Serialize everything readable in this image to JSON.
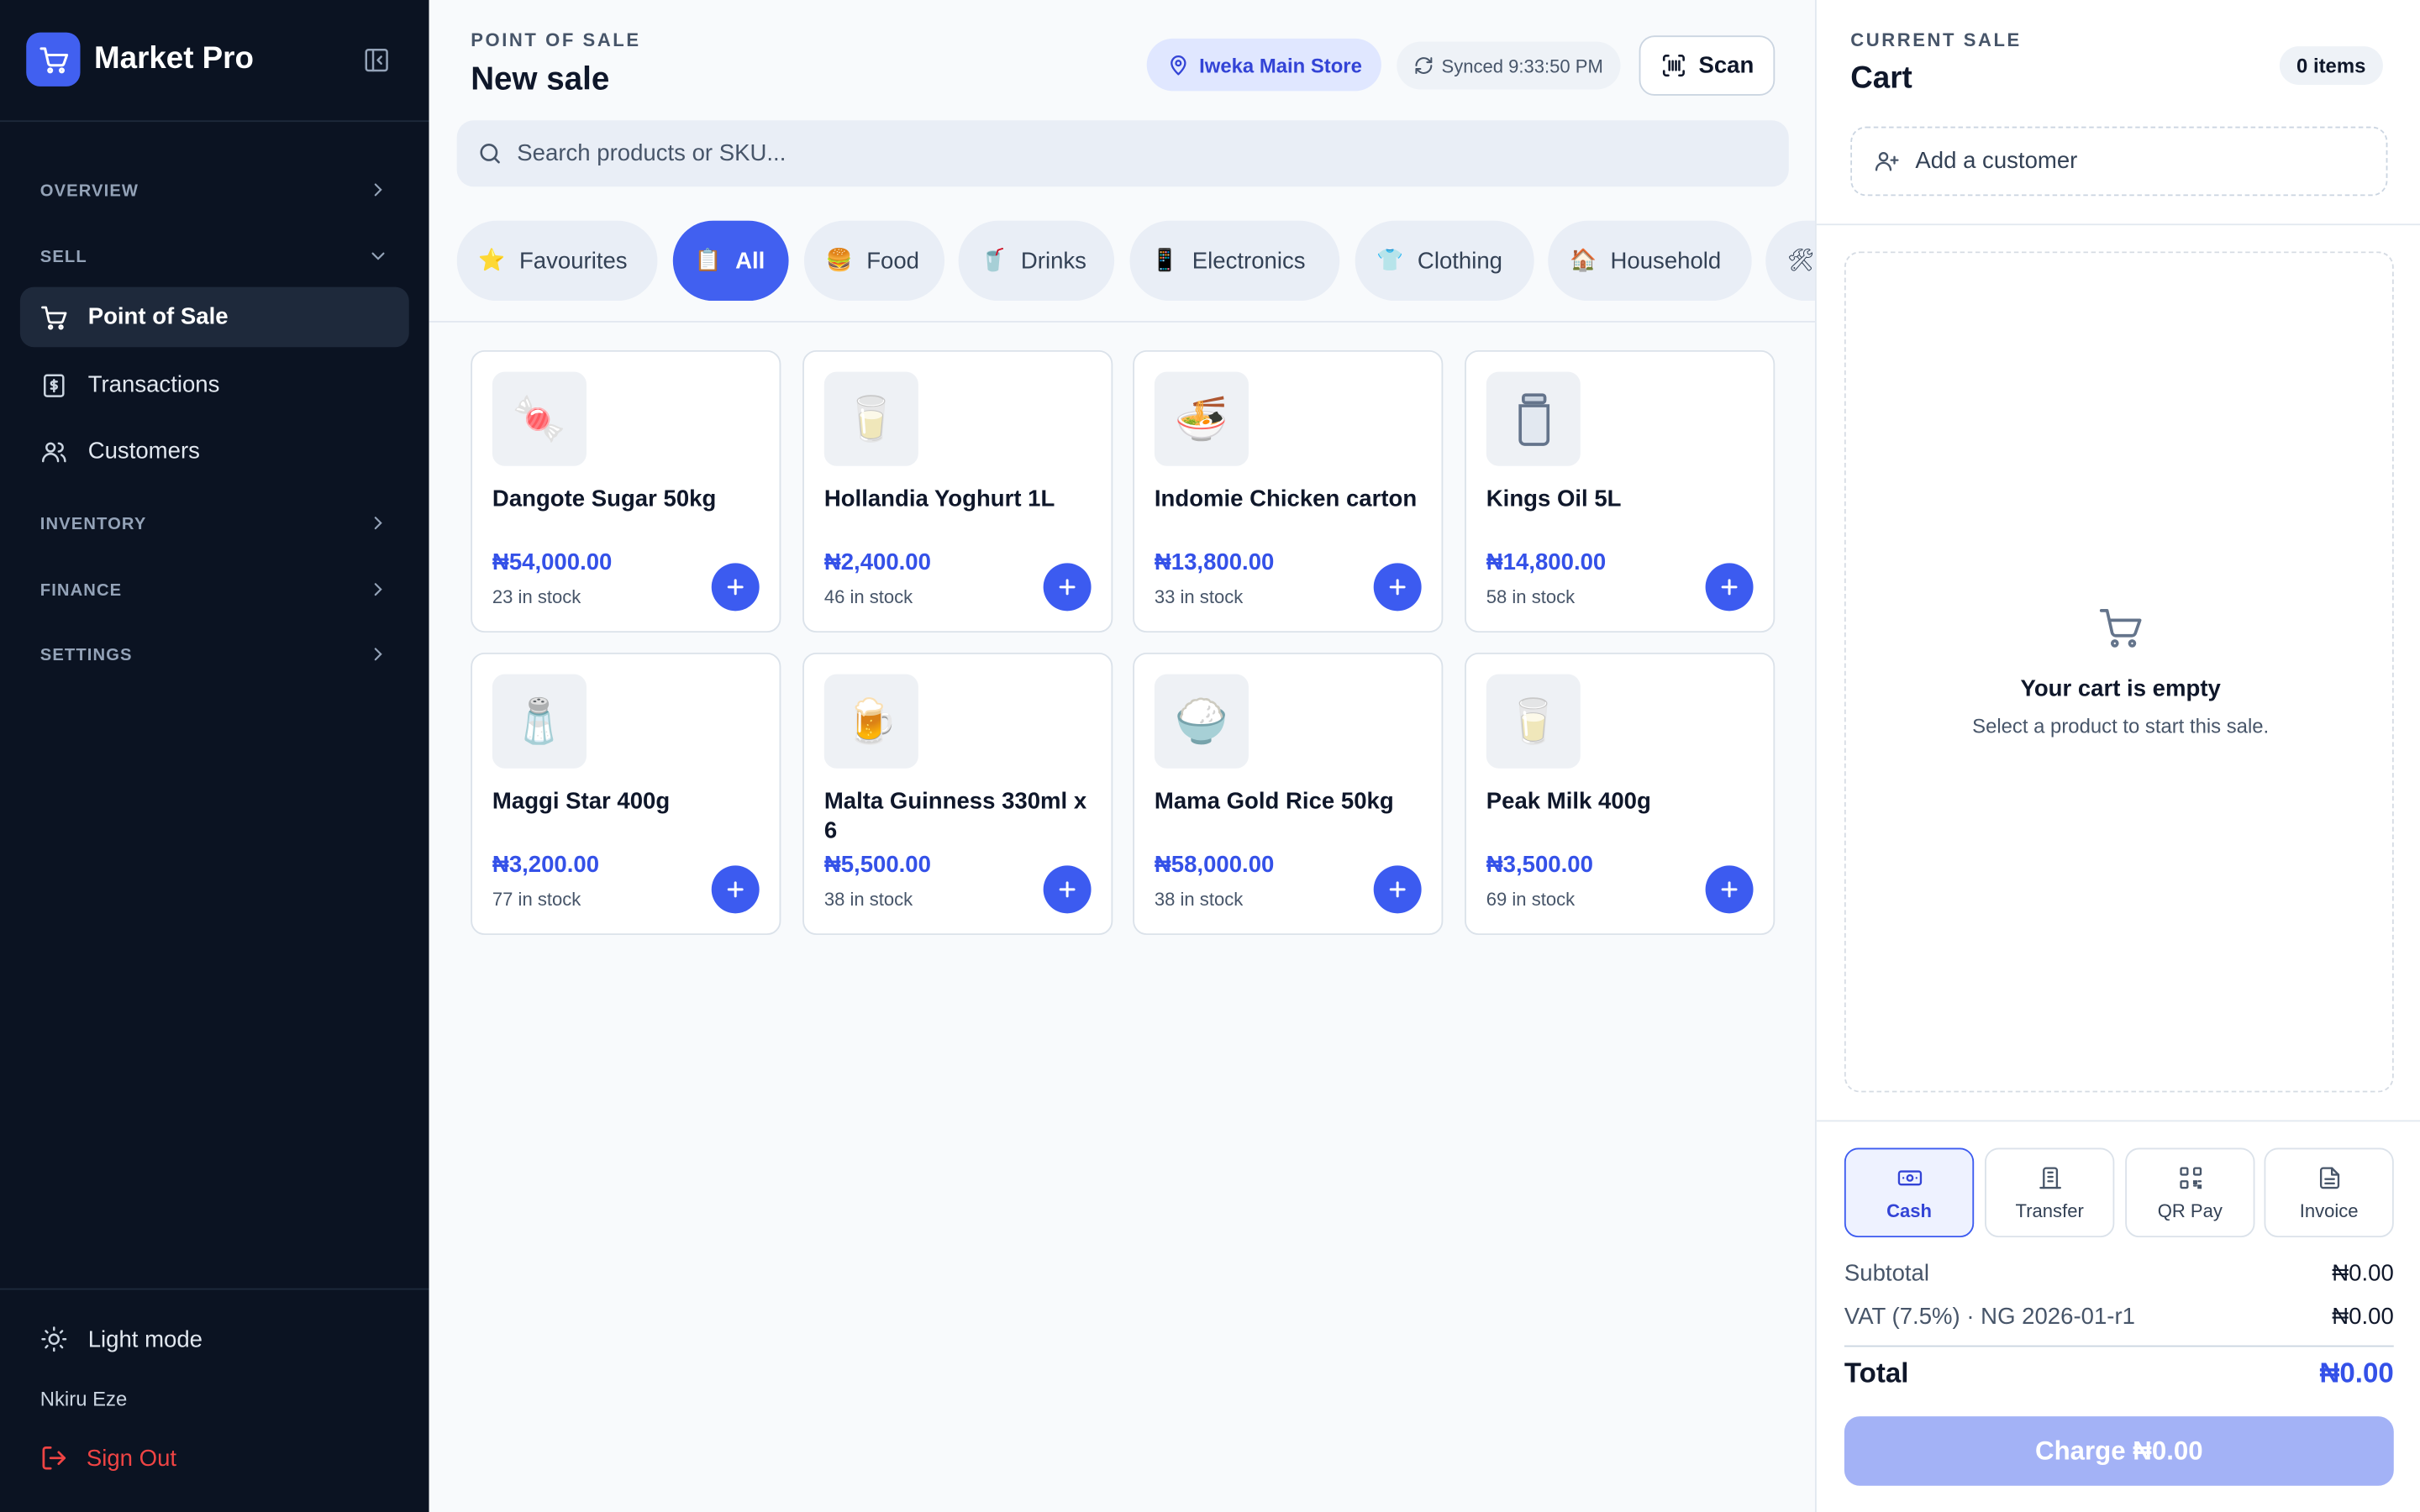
{
  "app": {
    "name": "Market Pro"
  },
  "sidebar": {
    "sections": {
      "overview": "OVERVIEW",
      "sell": "SELL",
      "inventory": "INVENTORY",
      "finance": "FINANCE",
      "settings": "SETTINGS"
    },
    "items": [
      {
        "label": "Point of Sale",
        "active": true
      },
      {
        "label": "Transactions",
        "active": false
      },
      {
        "label": "Customers",
        "active": false
      }
    ],
    "light_mode": "Light mode",
    "user_name": "Nkiru Eze",
    "sign_out": "Sign Out"
  },
  "header": {
    "eyebrow": "POINT OF SALE",
    "title": "New sale",
    "store": "Iweka Main Store",
    "sync": "Synced 9:33:50 PM",
    "scan": "Scan"
  },
  "search": {
    "placeholder": "Search products or SKU..."
  },
  "categories": [
    {
      "label": "Favourites",
      "emoji": "⭐",
      "active": false
    },
    {
      "label": "All",
      "emoji": "📋",
      "active": true
    },
    {
      "label": "Food",
      "emoji": "🍔",
      "active": false
    },
    {
      "label": "Drinks",
      "emoji": "🥤",
      "active": false
    },
    {
      "label": "Electronics",
      "emoji": "📱",
      "active": false
    },
    {
      "label": "Clothing",
      "emoji": "👕",
      "active": false
    },
    {
      "label": "Household",
      "emoji": "🏠",
      "active": false
    },
    {
      "label": "",
      "emoji": "🛠",
      "active": false
    }
  ],
  "products": [
    {
      "name": "Dangote Sugar 50kg",
      "price": "₦54,000.00",
      "stock": "23 in stock",
      "emoji": "🍬"
    },
    {
      "name": "Hollandia Yoghurt 1L",
      "price": "₦2,400.00",
      "stock": "46 in stock",
      "emoji": "🥛"
    },
    {
      "name": "Indomie Chicken carton",
      "price": "₦13,800.00",
      "stock": "33 in stock",
      "emoji": "🍜"
    },
    {
      "name": "Kings Oil 5L",
      "price": "₦14,800.00",
      "stock": "58 in stock",
      "emoji": "🫙"
    },
    {
      "name": "Maggi Star 400g",
      "price": "₦3,200.00",
      "stock": "77 in stock",
      "emoji": "🧂"
    },
    {
      "name": "Malta Guinness 330ml x 6",
      "price": "₦5,500.00",
      "stock": "38 in stock",
      "emoji": "🍺"
    },
    {
      "name": "Mama Gold Rice 50kg",
      "price": "₦58,000.00",
      "stock": "38 in stock",
      "emoji": "🍚"
    },
    {
      "name": "Peak Milk 400g",
      "price": "₦3,500.00",
      "stock": "69 in stock",
      "emoji": "🥛"
    }
  ],
  "cart": {
    "eyebrow": "CURRENT SALE",
    "title": "Cart",
    "items_badge": "0 items",
    "add_customer": "Add a customer",
    "empty_title": "Your cart is empty",
    "empty_sub": "Select a product to start this sale.",
    "payment_methods": [
      {
        "label": "Cash",
        "icon": "cash-icon",
        "active": true
      },
      {
        "label": "Transfer",
        "icon": "bank-icon",
        "active": false
      },
      {
        "label": "QR Pay",
        "icon": "qr-code-icon",
        "active": false
      },
      {
        "label": "Invoice",
        "icon": "document-icon",
        "active": false
      }
    ],
    "subtotal_label": "Subtotal",
    "subtotal_value": "₦0.00",
    "vat_label": "VAT (7.5%) · NG 2026-01-r1",
    "vat_value": "₦0.00",
    "total_label": "Total",
    "total_value": "₦0.00",
    "charge": "Charge ₦0.00"
  },
  "colors": {
    "accent": "#4160f0",
    "sidebar_bg": "#0b1322",
    "danger": "#ef4444",
    "price": "#3451e8"
  }
}
